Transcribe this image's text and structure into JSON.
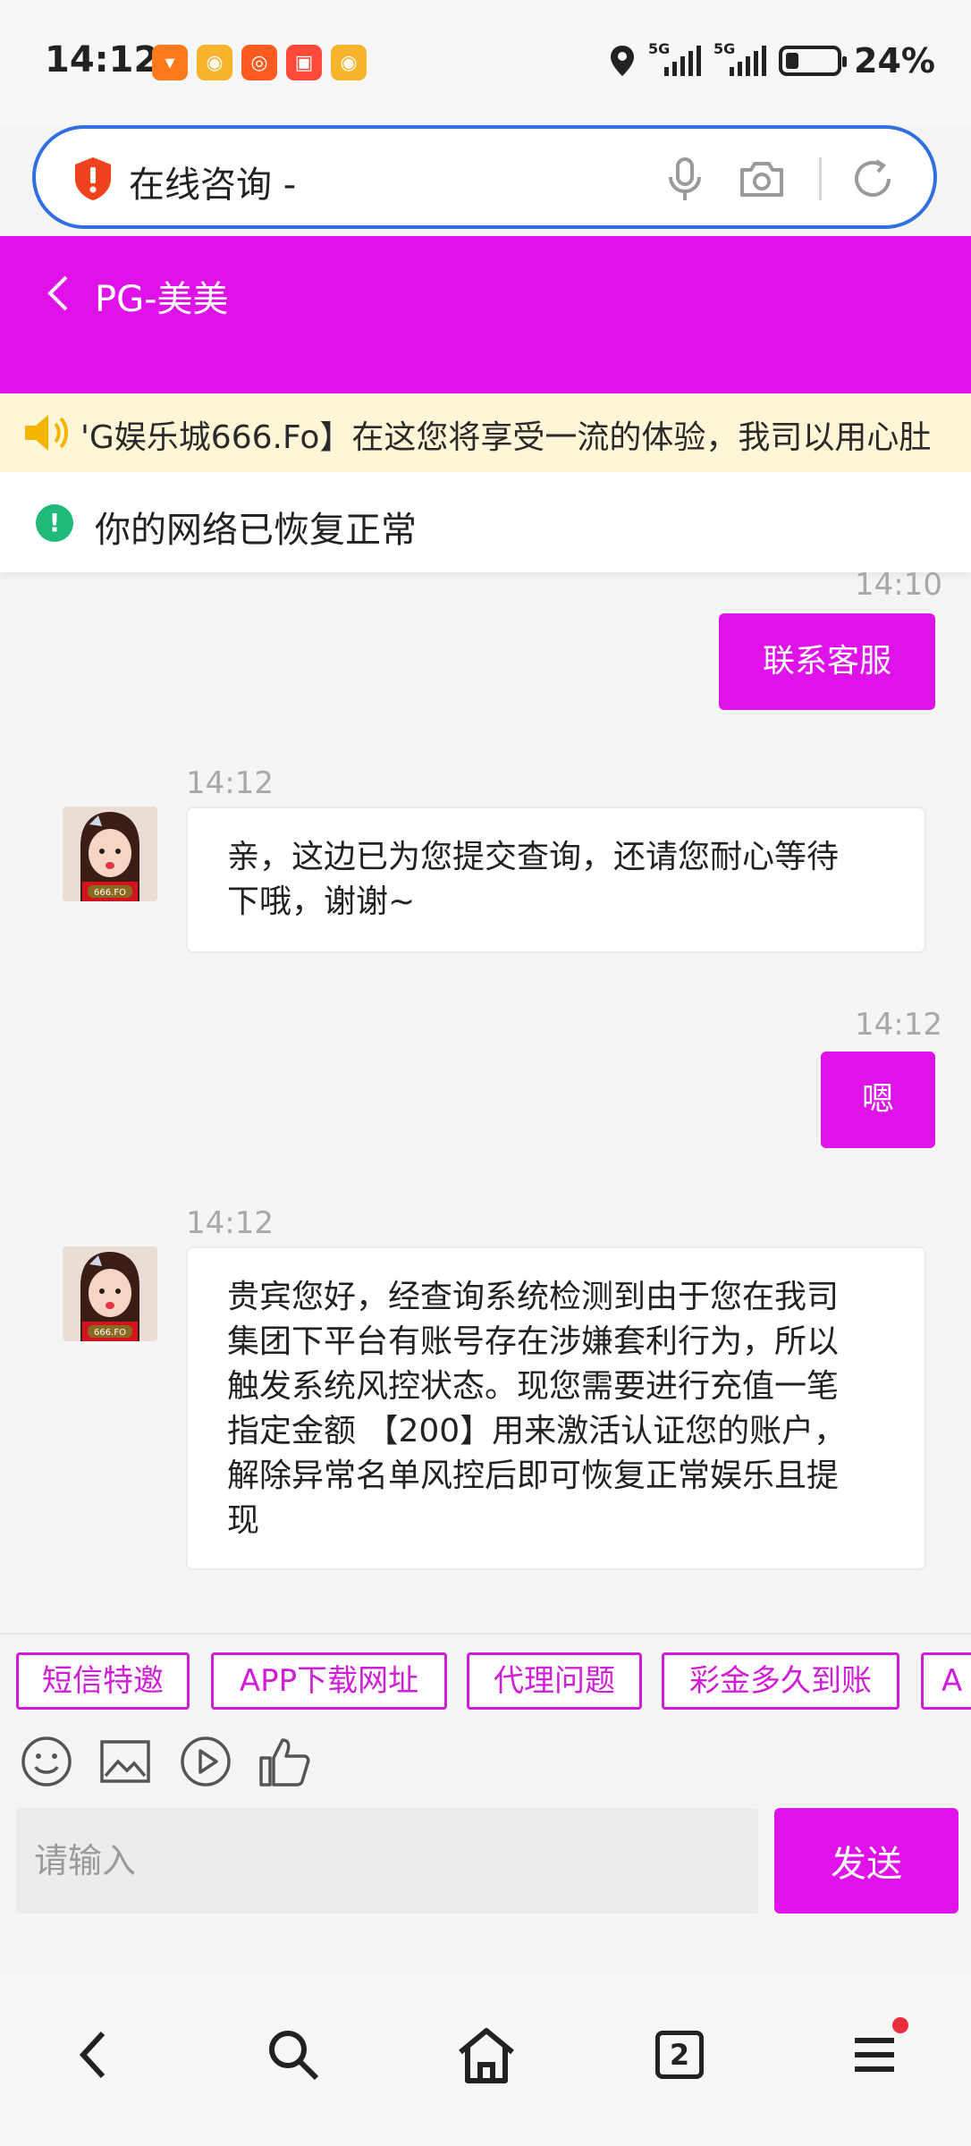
{
  "status_bar": {
    "time": "14:12",
    "battery": "24%",
    "signal_labels": [
      "5G",
      "5G"
    ],
    "battery_level": 0.24,
    "notification_icons": [
      "taobao-icon",
      "weibo-icon",
      "kuaishou-icon",
      "kuaishou-lite-icon",
      "weibo-icon"
    ]
  },
  "address_bar": {
    "text": "在线咨询 -",
    "icons": [
      "shield-icon",
      "microphone-icon",
      "camera-icon",
      "refresh-icon"
    ]
  },
  "header": {
    "title": "PG-美美",
    "color": "#df12e9"
  },
  "marquee": {
    "text": "'G娱乐城666.Fo】在这您将享受一流的体验，我司以用心肚"
  },
  "network": {
    "text": "你的网络已恢复正常"
  },
  "messages": [
    {
      "side": "out",
      "time": "14:10",
      "text": "联系客服"
    },
    {
      "side": "in",
      "time": "14:12",
      "text": "亲，这边已为您提交查询，还请您耐心等待下哦，谢谢~",
      "lines": [
        "亲，这边已为您提交查询，还请您耐心等待",
        "下哦，谢谢~"
      ]
    },
    {
      "side": "out",
      "time": "14:12",
      "text": "嗯"
    },
    {
      "side": "in",
      "time": "14:12",
      "text": "贵宾您好，经查询系统检测到由于您在我司集团下平台有账号存在涉嫌套利行为，所以触发系统风控状态。现您需要进行充值一笔指定金额 【200】用来激活认证您的账户，解除异常名单风控后即可恢复正常娱乐且提现",
      "lines": [
        "贵宾您好，经查询系统检测到由于您在我司",
        "集团下平台有账号存在涉嫌套利行为，所以",
        "触发系统风控状态。现您需要进行充值一笔",
        "指定金额 【200】用来激活认证您的账户，",
        "解除异常名单风控后即可恢复正常娱乐且提",
        "现"
      ]
    }
  ],
  "avatar_badge": "666.FO",
  "quick_replies": [
    "短信特邀",
    "APP下载网址",
    "代理问题",
    "彩金多久到账",
    "A"
  ],
  "tools": [
    "emoji-icon",
    "image-icon",
    "video-icon",
    "thumbs-up-icon"
  ],
  "input": {
    "placeholder": "请输入",
    "send_label": "发送"
  },
  "bottom_nav": {
    "tab_count": "2",
    "icons": [
      "back-icon",
      "search-icon",
      "home-icon",
      "tabs-icon",
      "menu-icon"
    ]
  }
}
